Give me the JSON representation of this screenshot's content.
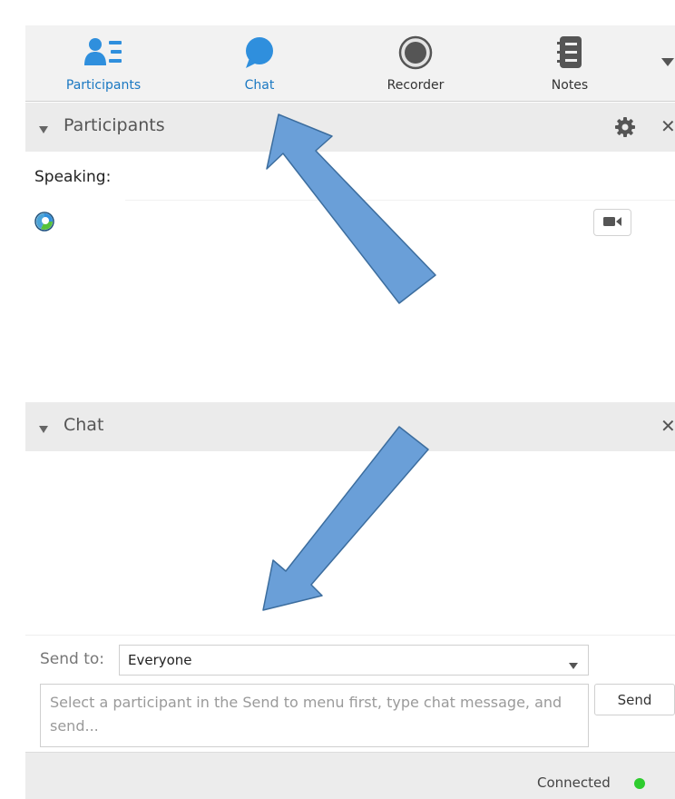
{
  "toolbar": {
    "tabs": [
      {
        "label": "Participants",
        "icon": "participants-icon",
        "active": true
      },
      {
        "label": "Chat",
        "icon": "chat-bubble-icon",
        "active": true
      },
      {
        "label": "Recorder",
        "icon": "record-icon",
        "active": false
      },
      {
        "label": "Notes",
        "icon": "notebook-icon",
        "active": false
      }
    ],
    "more_icon": "chevron-down-icon"
  },
  "participants_panel": {
    "title": "Participants",
    "speaking_label": "Speaking:",
    "participants": [
      {
        "name": "",
        "avatar_icon": "presence-icon",
        "action_icon": "video-camera-icon"
      }
    ]
  },
  "chat_panel": {
    "title": "Chat",
    "messages": []
  },
  "compose": {
    "send_to_label": "Send to:",
    "send_to_value": "Everyone",
    "message_placeholder": "Select a participant in the Send to menu first, type chat message, and send...",
    "message_value": "",
    "send_label": "Send"
  },
  "status": {
    "text": "Connected",
    "indicator_color": "#2ecc2e"
  },
  "colors": {
    "accent": "#1a78c2",
    "icon_blue": "#2f8fdd",
    "annotation_arrow_fill": "#6a9fd8",
    "annotation_arrow_stroke": "#3c6d9e"
  }
}
